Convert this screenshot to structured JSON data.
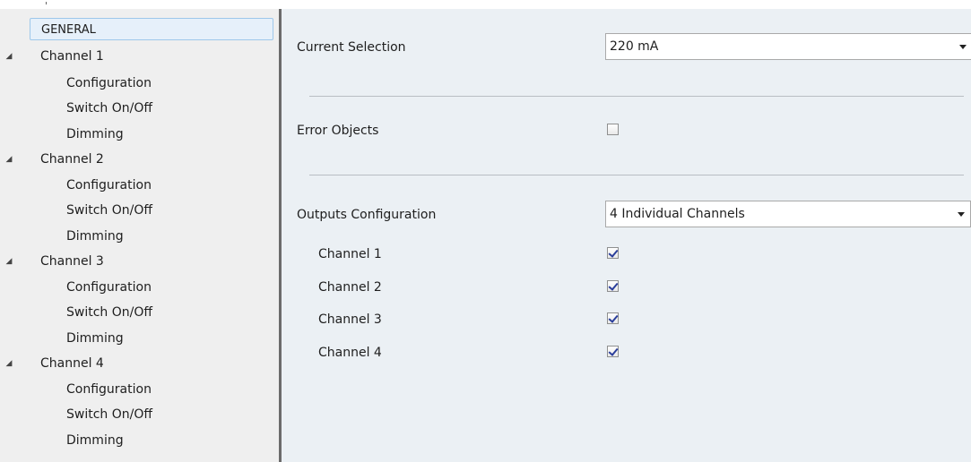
{
  "tree": {
    "general": "GENERAL",
    "channels": [
      {
        "label": "Channel 1",
        "children": [
          "Configuration",
          "Switch On/Off",
          "Dimming"
        ]
      },
      {
        "label": "Channel 2",
        "children": [
          "Configuration",
          "Switch On/Off",
          "Dimming"
        ]
      },
      {
        "label": "Channel 3",
        "children": [
          "Configuration",
          "Switch On/Off",
          "Dimming"
        ]
      },
      {
        "label": "Channel 4",
        "children": [
          "Configuration",
          "Switch On/Off",
          "Dimming"
        ]
      }
    ],
    "expand_icon": "collapse-triangle-icon"
  },
  "settings": {
    "current_selection": {
      "label": "Current Selection",
      "value": "220 mA"
    },
    "error_objects": {
      "label": "Error Objects",
      "checked": false
    },
    "outputs_configuration": {
      "label": "Outputs Configuration",
      "value": "4 Individual Channels"
    },
    "channels": [
      {
        "label": "Channel 1",
        "checked": true
      },
      {
        "label": "Channel 2",
        "checked": true
      },
      {
        "label": "Channel 3",
        "checked": true
      },
      {
        "label": "Channel 4",
        "checked": true
      }
    ]
  },
  "colors": {
    "sidebar_bg": "#efefef",
    "panel_bg": "#ebf0f4",
    "selection_bg": "#e6f0fa",
    "selection_border": "#9ec7ea",
    "check_mark": "#2a3e9b"
  }
}
